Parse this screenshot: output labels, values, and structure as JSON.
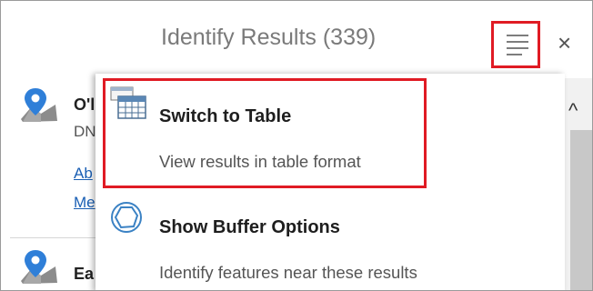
{
  "header": {
    "title": "Identify Results (339)",
    "close_glyph": "×",
    "menu_icon": "hamburger-menu-icon"
  },
  "results": [
    {
      "name": "O'l",
      "subtitle": "DN",
      "links": [
        "Ab",
        "Me"
      ],
      "icon": "map-pin-icon"
    },
    {
      "name": "Ea",
      "icon": "map-pin-icon"
    }
  ],
  "dropdown": {
    "items": [
      {
        "title": "Switch to Table",
        "description": "View results in table format",
        "icon": "table-icon"
      },
      {
        "title": "Show Buffer Options",
        "description": "Identify features near these results",
        "icon": "buffer-icon"
      }
    ]
  },
  "scrollbar": {
    "up_glyph": "^"
  },
  "colors": {
    "highlight": "#e01b24",
    "link": "#1a5fb4",
    "title": "#7a7a7a"
  }
}
